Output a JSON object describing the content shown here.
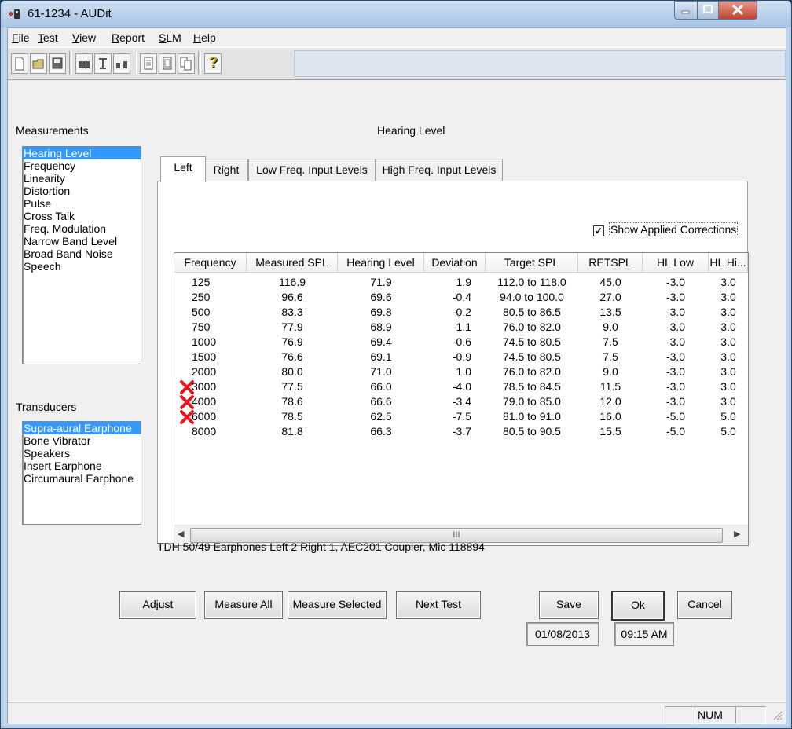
{
  "window": {
    "title": "61-1234 - AUDit"
  },
  "menu": {
    "items": [
      "File",
      "Test",
      "View",
      "Report",
      "SLM",
      "Help"
    ],
    "underline_letters": [
      "F",
      "T",
      "V",
      "R",
      "S",
      "H"
    ]
  },
  "toolbar": {
    "icons": [
      "new-icon",
      "open-icon",
      "save-icon",
      "earphones-icon",
      "coupler-icon",
      "speakers-icon",
      "report-icon",
      "report-preview-icon",
      "report-copy-icon",
      "help-icon"
    ],
    "help_glyph": "?"
  },
  "measurements": {
    "label": "Measurements",
    "items": [
      "Hearing Level",
      "Frequency",
      "Linearity",
      "Distortion",
      "Pulse",
      "Cross Talk",
      "Freq. Modulation",
      "Narrow Band Level",
      "Broad Band Noise",
      "Speech"
    ],
    "selected": "Hearing Level"
  },
  "transducers": {
    "label": "Transducers",
    "items": [
      "Supra-aural Earphone",
      "Bone Vibrator",
      "Speakers",
      "Insert Earphone",
      "Circumaural Earphone"
    ],
    "selected": "Supra-aural Earphone"
  },
  "panel_title": "Hearing Level",
  "tabs": [
    "Left",
    "Right",
    "Low Freq. Input Levels",
    "High Freq. Input Levels"
  ],
  "active_tab": "Left",
  "show_corrections": {
    "label": "Show Applied Corrections",
    "checked": true,
    "check_glyph": "✓"
  },
  "table": {
    "headers": [
      "Frequency",
      "Measured SPL",
      "Hearing Level",
      "Deviation",
      "Target SPL",
      "RETSPL",
      "HL Low",
      "HL Hi..."
    ],
    "rows": [
      {
        "frequency": "125",
        "measured_spl": "116.9",
        "hearing_level": "71.9",
        "deviation": "1.9",
        "target_spl": "112.0 to 118.0",
        "retspl": "45.0",
        "hl_low": "-3.0",
        "hl_high": "3.0",
        "fail": false
      },
      {
        "frequency": "250",
        "measured_spl": "96.6",
        "hearing_level": "69.6",
        "deviation": "-0.4",
        "target_spl": "94.0 to 100.0",
        "retspl": "27.0",
        "hl_low": "-3.0",
        "hl_high": "3.0",
        "fail": false
      },
      {
        "frequency": "500",
        "measured_spl": "83.3",
        "hearing_level": "69.8",
        "deviation": "-0.2",
        "target_spl": "80.5 to 86.5",
        "retspl": "13.5",
        "hl_low": "-3.0",
        "hl_high": "3.0",
        "fail": false
      },
      {
        "frequency": "750",
        "measured_spl": "77.9",
        "hearing_level": "68.9",
        "deviation": "-1.1",
        "target_spl": "76.0 to 82.0",
        "retspl": "9.0",
        "hl_low": "-3.0",
        "hl_high": "3.0",
        "fail": false
      },
      {
        "frequency": "1000",
        "measured_spl": "76.9",
        "hearing_level": "69.4",
        "deviation": "-0.6",
        "target_spl": "74.5 to 80.5",
        "retspl": "7.5",
        "hl_low": "-3.0",
        "hl_high": "3.0",
        "fail": false
      },
      {
        "frequency": "1500",
        "measured_spl": "76.6",
        "hearing_level": "69.1",
        "deviation": "-0.9",
        "target_spl": "74.5 to 80.5",
        "retspl": "7.5",
        "hl_low": "-3.0",
        "hl_high": "3.0",
        "fail": false
      },
      {
        "frequency": "2000",
        "measured_spl": "80.0",
        "hearing_level": "71.0",
        "deviation": "1.0",
        "target_spl": "76.0 to 82.0",
        "retspl": "9.0",
        "hl_low": "-3.0",
        "hl_high": "3.0",
        "fail": false
      },
      {
        "frequency": "3000",
        "measured_spl": "77.5",
        "hearing_level": "66.0",
        "deviation": "-4.0",
        "target_spl": "78.5 to 84.5",
        "retspl": "11.5",
        "hl_low": "-3.0",
        "hl_high": "3.0",
        "fail": true
      },
      {
        "frequency": "4000",
        "measured_spl": "78.6",
        "hearing_level": "66.6",
        "deviation": "-3.4",
        "target_spl": "79.0 to 85.0",
        "retspl": "12.0",
        "hl_low": "-3.0",
        "hl_high": "3.0",
        "fail": true
      },
      {
        "frequency": "6000",
        "measured_spl": "78.5",
        "hearing_level": "62.5",
        "deviation": "-7.5",
        "target_spl": "81.0 to 91.0",
        "retspl": "16.0",
        "hl_low": "-5.0",
        "hl_high": "5.0",
        "fail": true
      },
      {
        "frequency": "8000",
        "measured_spl": "81.8",
        "hearing_level": "66.3",
        "deviation": "-3.7",
        "target_spl": "80.5 to 90.5",
        "retspl": "15.5",
        "hl_low": "-5.0",
        "hl_high": "5.0",
        "fail": false
      }
    ],
    "fail_icon": "red-x-icon",
    "fail_color": "#e8141a",
    "scrollbar_grip": "III"
  },
  "equipment_info": "TDH 50/49 Earphones Left 2 Right 1, AEC201 Coupler, Mic 118894",
  "buttons": {
    "adjust": "Adjust",
    "measure_all": "Measure All",
    "measure_selected": "Measure Selected",
    "next_test": "Next Test",
    "save": "Save",
    "ok": "Ok",
    "cancel": "Cancel"
  },
  "datetime": {
    "date": "01/08/2013",
    "time": "09:15 AM"
  },
  "statusbar": {
    "num": "NUM"
  },
  "colors": {
    "selection": "#3399ff",
    "titlebar": "#bcd3ec"
  }
}
